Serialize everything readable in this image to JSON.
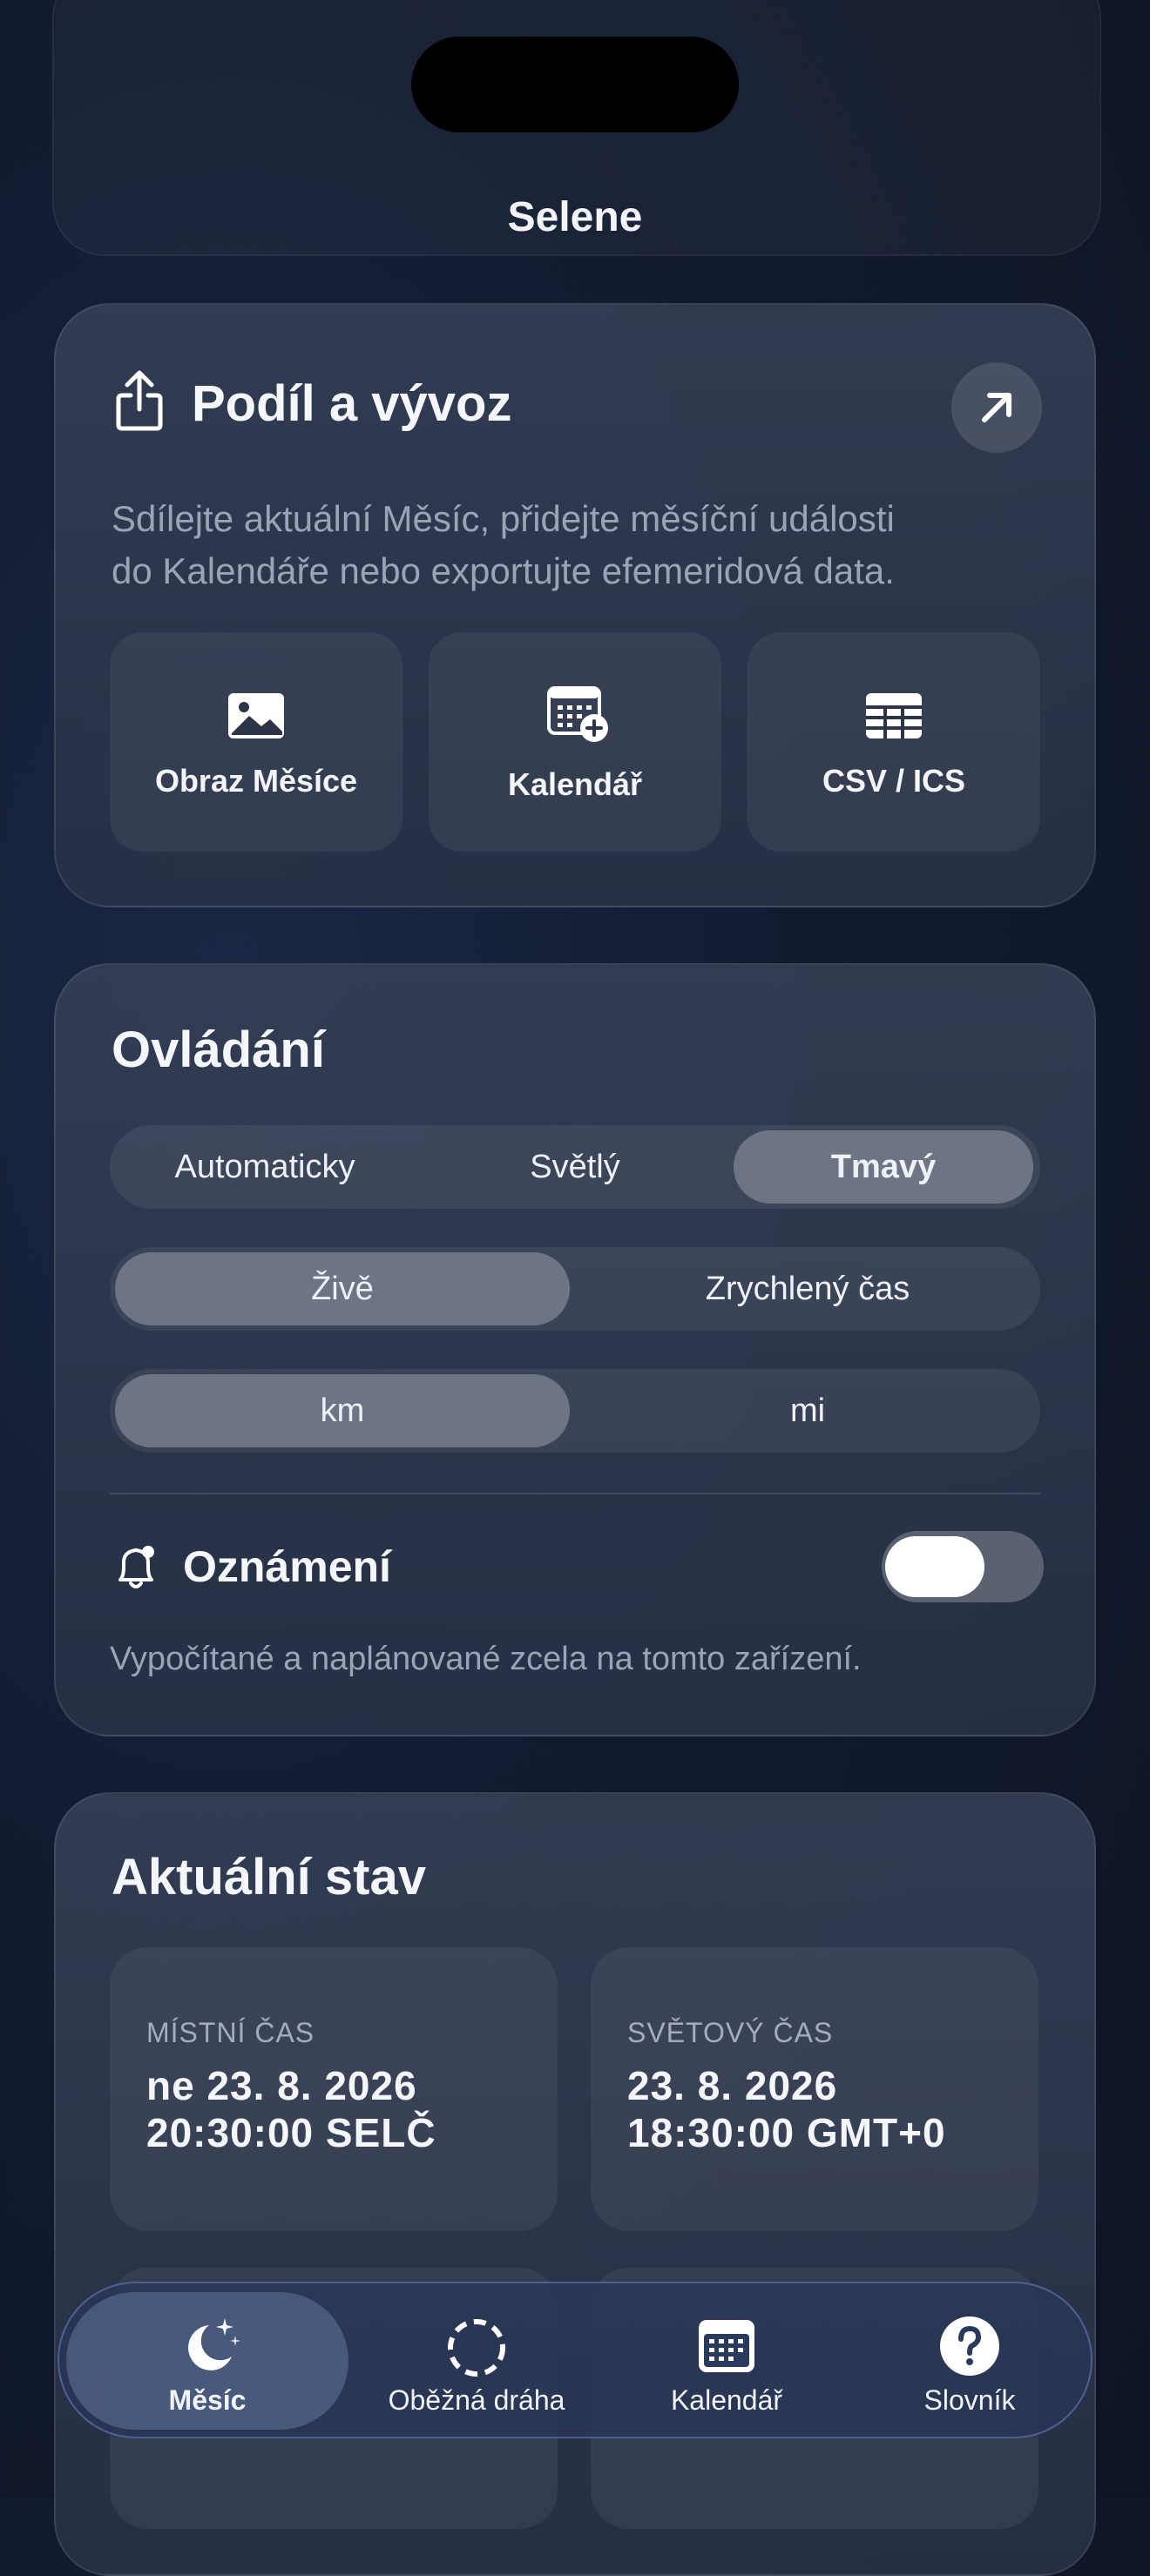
{
  "app": {
    "title": "Selene"
  },
  "share": {
    "title": "Podíl a vývoz",
    "description_line1": "Sdílejte aktuální Měsíc, přidejte měsíční události",
    "description_line2": "do Kalendáře nebo exportujte efemeridová data.",
    "actions": [
      {
        "label": "Obraz Měsíce",
        "icon": "image-icon"
      },
      {
        "label": "Kalendář",
        "icon": "calendar-add-icon"
      },
      {
        "label": "CSV / ICS",
        "icon": "table-icon"
      }
    ]
  },
  "controls": {
    "title": "Ovládání",
    "theme": {
      "options": [
        "Automaticky",
        "Světlý",
        "Tmavý"
      ],
      "selected": "Tmavý"
    },
    "time": {
      "options": [
        "Živě",
        "Zrychlený čas"
      ],
      "selected": "Živě"
    },
    "units": {
      "options": [
        "km",
        "mi"
      ],
      "selected": "km"
    },
    "notifications": {
      "label": "Oznámení",
      "enabled": true,
      "note": "Vypočítané a naplánované zcela na tomto zařízení."
    }
  },
  "status": {
    "title": "Aktuální stav",
    "local_time": {
      "label": "MÍSTNÍ ČAS",
      "line1": "ne 23. 8. 2026",
      "line2": "20:30:00 SELČ"
    },
    "utc_time": {
      "label": "SVĚTOVÝ ČAS",
      "line1": "23. 8. 2026",
      "line2": "18:30:00 GMT+0"
    }
  },
  "tabbar": {
    "tabs": [
      {
        "label": "Měsíc",
        "icon": "moon-stars-icon",
        "selected": true
      },
      {
        "label": "Oběžná dráha",
        "icon": "orbit-icon",
        "selected": false
      },
      {
        "label": "Kalendář",
        "icon": "calendar-icon",
        "selected": false
      },
      {
        "label": "Slovník",
        "icon": "question-icon",
        "selected": false
      }
    ]
  },
  "colors": {
    "background": "#121b30",
    "card": "#343e54",
    "segment_selected": "#6d7585",
    "toggle_on": "#5a6272",
    "tabbar_border": "#7896dc"
  }
}
